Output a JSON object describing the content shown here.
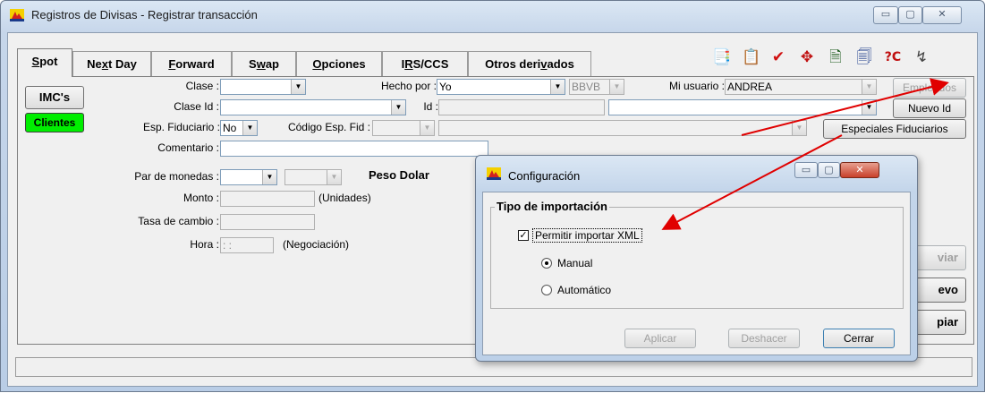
{
  "window": {
    "title": "Registros de Divisas - Registrar transacción",
    "min_glyph": "▭",
    "max_glyph": "▢",
    "close_glyph": "✕"
  },
  "tabs": [
    {
      "pre": "",
      "u": "S",
      "post": "pot"
    },
    {
      "pre": "Ne",
      "u": "x",
      "post": "t Day"
    },
    {
      "pre": "",
      "u": "F",
      "post": "orward"
    },
    {
      "pre": "S",
      "u": "w",
      "post": "ap"
    },
    {
      "pre": "",
      "u": "O",
      "post": "pciones"
    },
    {
      "pre": "I",
      "u": "R",
      "post": "S/CCS"
    },
    {
      "pre": "Otros deri",
      "u": "v",
      "post": "ados"
    }
  ],
  "toolbar_icons": [
    "📑",
    "📋",
    "✔",
    "✥",
    "🗎",
    "🗐",
    "?C",
    "↯"
  ],
  "form": {
    "imcs_label": "IMC's",
    "clientes_label": "Clientes",
    "clase_label": "Clase :",
    "clase_value": "",
    "hecho_por_label": "Hecho por :",
    "hecho_por_value": "Yo",
    "bank_value": "BBVB",
    "mi_usuario_label": "Mi usuario :",
    "mi_usuario_value": "ANDREA",
    "empleados_label": "Empleados",
    "clase_id_label": "Clase Id :",
    "id_label": "Id :",
    "nuevo_id_label": "Nuevo Id",
    "esp_fid_label": "Esp. Fiduciario :",
    "esp_fid_value": "No",
    "codigo_label": "Código Esp. Fid :",
    "especiales_label": "Especiales Fiduciarios",
    "comentario_label": "Comentario :",
    "par_label": "Par de monedas :",
    "peso_dolar_label": "Peso Dolar",
    "monto_label": "Monto :",
    "unidades_label": "(Unidades)",
    "tasa_label": "Tasa de cambio :",
    "hora_label": "Hora :",
    "hora_value": " : :",
    "negociacion_label": "(Negociación)",
    "enviar_label": "viar",
    "nuevo_label": "evo",
    "limpiar_label": "piar"
  },
  "dialog": {
    "title": "Configuración",
    "group_title": "Tipo de importación",
    "checkbox_label": "Permitir importar XML",
    "checkbox_checked": true,
    "radio_manual": "Manual",
    "radio_auto": "Automático",
    "selected": "Manual",
    "aplicar": "Aplicar",
    "deshacer": "Deshacer",
    "cerrar": "Cerrar"
  },
  "colors": {
    "clientes_button": "#00ee00",
    "annotation_arrow": "#e00000"
  }
}
